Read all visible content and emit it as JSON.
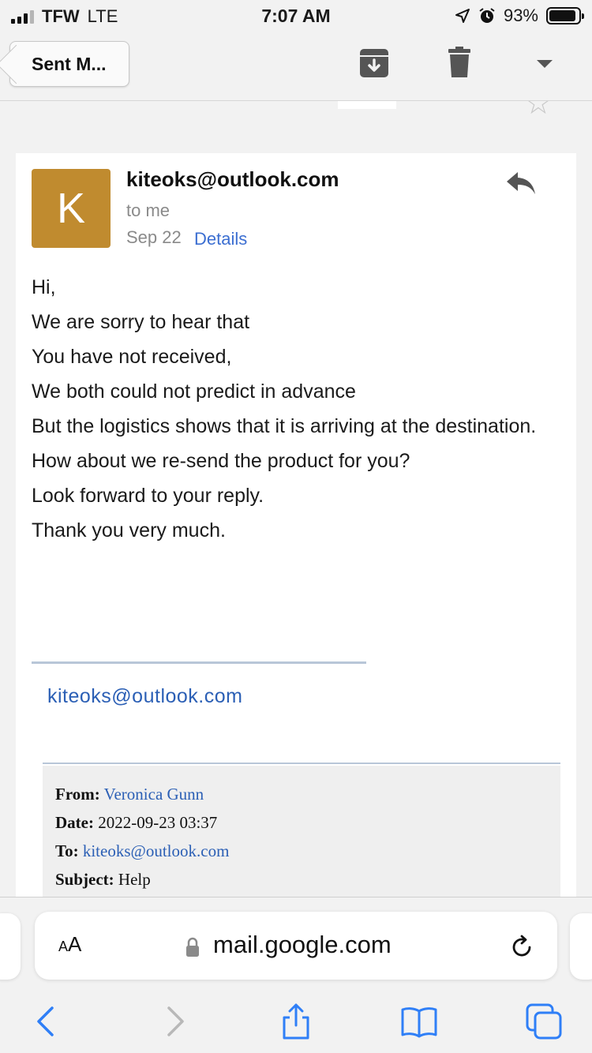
{
  "status_bar": {
    "carrier": "TFW",
    "network": "LTE",
    "time": "7:07 AM",
    "battery": "93%",
    "battery_level": 0.93
  },
  "toolbar": {
    "back_label": "Sent M...",
    "icons": [
      "archive-icon",
      "delete-icon",
      "more-dropdown-icon"
    ]
  },
  "email": {
    "avatar_letter": "K",
    "avatar_color": "#c08b2f",
    "sender": "kiteoks@outlook.com",
    "recipient": "to me",
    "date": "Sep 22",
    "details_label": "Details",
    "body_lines": [
      "Hi,",
      "We are sorry to hear that",
      "You have not received,",
      "We both could not predict in advance",
      "But the logistics shows that it is arriving at the destination.",
      "How about we re-send the product for you?",
      "Look forward to your reply.",
      "Thank you very much."
    ],
    "signature_email": "kiteoks@outlook.com",
    "quoted": {
      "from_label": "From:",
      "from_value": "Veronica Gunn",
      "date_label": "Date:",
      "date_value": "2022-09-23 03:37",
      "to_label": "To:",
      "to_value": "kiteoks@outlook.com",
      "subject_label": "Subject:",
      "subject_value": "Help"
    }
  },
  "safari": {
    "aa_big": "A",
    "aa_small": "A",
    "url": "mail.google.com",
    "nav_icons": [
      "back-icon",
      "forward-icon",
      "share-icon",
      "bookmarks-icon",
      "tabs-icon"
    ]
  },
  "colors": {
    "link": "#2b5fb5",
    "ios_blue": "#2f7ff7",
    "background": "#f2f2f2"
  }
}
